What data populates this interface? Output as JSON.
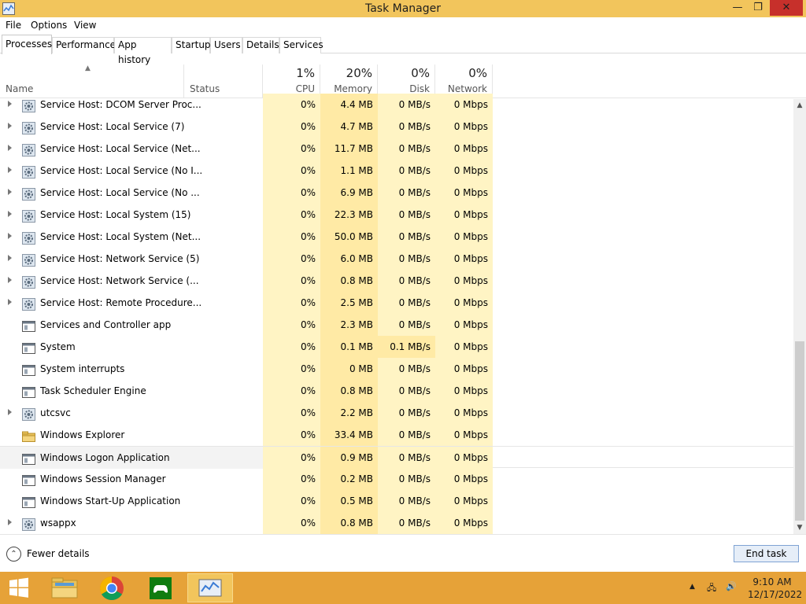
{
  "window": {
    "title": "Task Manager",
    "minimize": "—",
    "maximize": "❐",
    "close": "✕"
  },
  "menu": {
    "file": "File",
    "options": "Options",
    "view": "View"
  },
  "tabs": [
    {
      "label": "Processes",
      "active": true
    },
    {
      "label": "Performance"
    },
    {
      "label": "App history"
    },
    {
      "label": "Startup"
    },
    {
      "label": "Users"
    },
    {
      "label": "Details"
    },
    {
      "label": "Services"
    }
  ],
  "header": {
    "sort_arrow": "▲",
    "name": "Name",
    "status": "Status",
    "cpu": {
      "pct": "1%",
      "label": "CPU"
    },
    "memory": {
      "pct": "20%",
      "label": "Memory"
    },
    "disk": {
      "pct": "0%",
      "label": "Disk"
    },
    "network": {
      "pct": "0%",
      "label": "Network"
    }
  },
  "colors": {
    "heat_light": "#fff4c4",
    "heat_medium": "#ffeaa5",
    "titlebar": "#f2c55c",
    "taskbar": "#e6a238",
    "close": "#c7302b"
  },
  "processes": [
    {
      "name": "Service Host: DCOM Server Proc...",
      "icon": "gear-icon",
      "expandable": true,
      "cpu": "0%",
      "memory": "4.4 MB",
      "disk": "0 MB/s",
      "network": "0 Mbps"
    },
    {
      "name": "Service Host: Local Service (7)",
      "icon": "gear-icon",
      "expandable": true,
      "cpu": "0%",
      "memory": "4.7 MB",
      "disk": "0 MB/s",
      "network": "0 Mbps"
    },
    {
      "name": "Service Host: Local Service (Net...",
      "icon": "gear-icon",
      "expandable": true,
      "cpu": "0%",
      "memory": "11.7 MB",
      "disk": "0 MB/s",
      "network": "0 Mbps"
    },
    {
      "name": "Service Host: Local Service (No I...",
      "icon": "gear-icon",
      "expandable": true,
      "cpu": "0%",
      "memory": "1.1 MB",
      "disk": "0 MB/s",
      "network": "0 Mbps"
    },
    {
      "name": "Service Host: Local Service (No ...",
      "icon": "gear-icon",
      "expandable": true,
      "cpu": "0%",
      "memory": "6.9 MB",
      "disk": "0 MB/s",
      "network": "0 Mbps"
    },
    {
      "name": "Service Host: Local System (15)",
      "icon": "gear-icon",
      "expandable": true,
      "cpu": "0%",
      "memory": "22.3 MB",
      "disk": "0 MB/s",
      "network": "0 Mbps"
    },
    {
      "name": "Service Host: Local System (Net...",
      "icon": "gear-icon",
      "expandable": true,
      "cpu": "0%",
      "memory": "50.0 MB",
      "disk": "0 MB/s",
      "network": "0 Mbps"
    },
    {
      "name": "Service Host: Network Service (5)",
      "icon": "gear-icon",
      "expandable": true,
      "cpu": "0%",
      "memory": "6.0 MB",
      "disk": "0 MB/s",
      "network": "0 Mbps"
    },
    {
      "name": "Service Host: Network Service (...",
      "icon": "gear-icon",
      "expandable": true,
      "cpu": "0%",
      "memory": "0.8 MB",
      "disk": "0 MB/s",
      "network": "0 Mbps"
    },
    {
      "name": "Service Host: Remote Procedure...",
      "icon": "gear-icon",
      "expandable": true,
      "cpu": "0%",
      "memory": "2.5 MB",
      "disk": "0 MB/s",
      "network": "0 Mbps"
    },
    {
      "name": "Services and Controller app",
      "icon": "window-icon",
      "expandable": false,
      "cpu": "0%",
      "memory": "2.3 MB",
      "disk": "0 MB/s",
      "network": "0 Mbps"
    },
    {
      "name": "System",
      "icon": "window-icon",
      "expandable": false,
      "cpu": "0%",
      "memory": "0.1 MB",
      "disk": "0.1 MB/s",
      "network": "0 Mbps",
      "disk_highlight": true
    },
    {
      "name": "System interrupts",
      "icon": "window-icon",
      "expandable": false,
      "cpu": "0%",
      "memory": "0 MB",
      "disk": "0 MB/s",
      "network": "0 Mbps"
    },
    {
      "name": "Task Scheduler Engine",
      "icon": "window-icon",
      "expandable": false,
      "cpu": "0%",
      "memory": "0.8 MB",
      "disk": "0 MB/s",
      "network": "0 Mbps"
    },
    {
      "name": "utcsvc",
      "icon": "gear-icon",
      "expandable": true,
      "cpu": "0%",
      "memory": "2.2 MB",
      "disk": "0 MB/s",
      "network": "0 Mbps"
    },
    {
      "name": "Windows Explorer",
      "icon": "folder-icon",
      "expandable": false,
      "cpu": "0%",
      "memory": "33.4 MB",
      "disk": "0 MB/s",
      "network": "0 Mbps"
    },
    {
      "name": "Windows Logon Application",
      "icon": "window-icon",
      "expandable": false,
      "cpu": "0%",
      "memory": "0.9 MB",
      "disk": "0 MB/s",
      "network": "0 Mbps",
      "selected": true
    },
    {
      "name": "Windows Session Manager",
      "icon": "window-icon",
      "expandable": false,
      "cpu": "0%",
      "memory": "0.2 MB",
      "disk": "0 MB/s",
      "network": "0 Mbps"
    },
    {
      "name": "Windows Start-Up Application",
      "icon": "window-icon",
      "expandable": false,
      "cpu": "0%",
      "memory": "0.5 MB",
      "disk": "0 MB/s",
      "network": "0 Mbps"
    },
    {
      "name": "wsappx",
      "icon": "gear-icon",
      "expandable": true,
      "cpu": "0%",
      "memory": "0.8 MB",
      "disk": "0 MB/s",
      "network": "0 Mbps"
    }
  ],
  "scrollbar": {
    "up": "▲",
    "down": "▼"
  },
  "footer": {
    "fewer_icon": "⌃",
    "fewer_details": "Fewer details",
    "end_task": "End task"
  },
  "taskbar": {
    "apps": [
      "start-icon",
      "file-explorer-icon",
      "chrome-icon",
      "xbox-icon",
      "task-manager-icon"
    ],
    "tray": {
      "arrow": "▲",
      "network": "🖧",
      "volume": "🔊"
    },
    "time": "9:10 AM",
    "date": "12/17/2022"
  }
}
